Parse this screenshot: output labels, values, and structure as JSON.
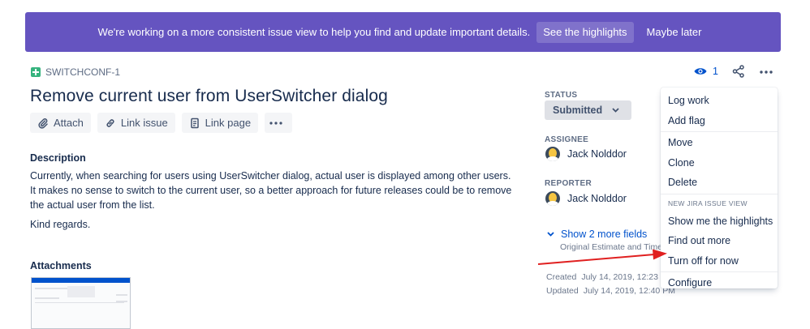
{
  "banner": {
    "message": "We're working on a more consistent issue view to help you find and update important details.",
    "primary_label": "See the highlights",
    "secondary_label": "Maybe later"
  },
  "issue": {
    "key": "SWITCHCONF-1",
    "title": "Remove current user from UserSwitcher dialog"
  },
  "actions": {
    "attach": "Attach",
    "link_issue": "Link issue",
    "link_page": "Link page",
    "more": "•••"
  },
  "description": {
    "heading": "Description",
    "text": "Currently, when searching for users using UserSwitcher dialog, actual user is displayed among other users. It makes no sense to switch to the current user, so a better approach for future releases could be to remove the actual user from the list.",
    "closing": "Kind regards."
  },
  "attachments": {
    "heading": "Attachments"
  },
  "fields": {
    "status_label": "STATUS",
    "status_value": "Submitted",
    "assignee_label": "ASSIGNEE",
    "assignee_name": "Jack Nolddor",
    "reporter_label": "REPORTER",
    "reporter_name": "Jack Nolddor",
    "show_more": "Show 2 more fields",
    "more_fields": "Original Estimate and Time"
  },
  "dates": {
    "created_label": "Created",
    "created_value": "July 14, 2019, 12:23",
    "updated_label": "Updated",
    "updated_value": "July 14, 2019, 12:40 PM"
  },
  "header_icons": {
    "watch_count": "1"
  },
  "menu": {
    "items_group1": [
      "Log work",
      "Add flag"
    ],
    "items_group2": [
      "Move",
      "Clone",
      "Delete"
    ],
    "group_label": "NEW JIRA ISSUE VIEW",
    "items_group3": [
      "Show me the highlights",
      "Find out more",
      "Turn off for now"
    ],
    "items_group4": [
      "Configure"
    ]
  },
  "colors": {
    "banner": "#6554c0",
    "link": "#0052cc",
    "arrow": "#e02020"
  },
  "icons": [
    "plus-square-icon",
    "paperclip-icon",
    "link-icon",
    "page-icon",
    "more-icon",
    "chevron-down-icon",
    "eye-icon",
    "share-icon"
  ]
}
